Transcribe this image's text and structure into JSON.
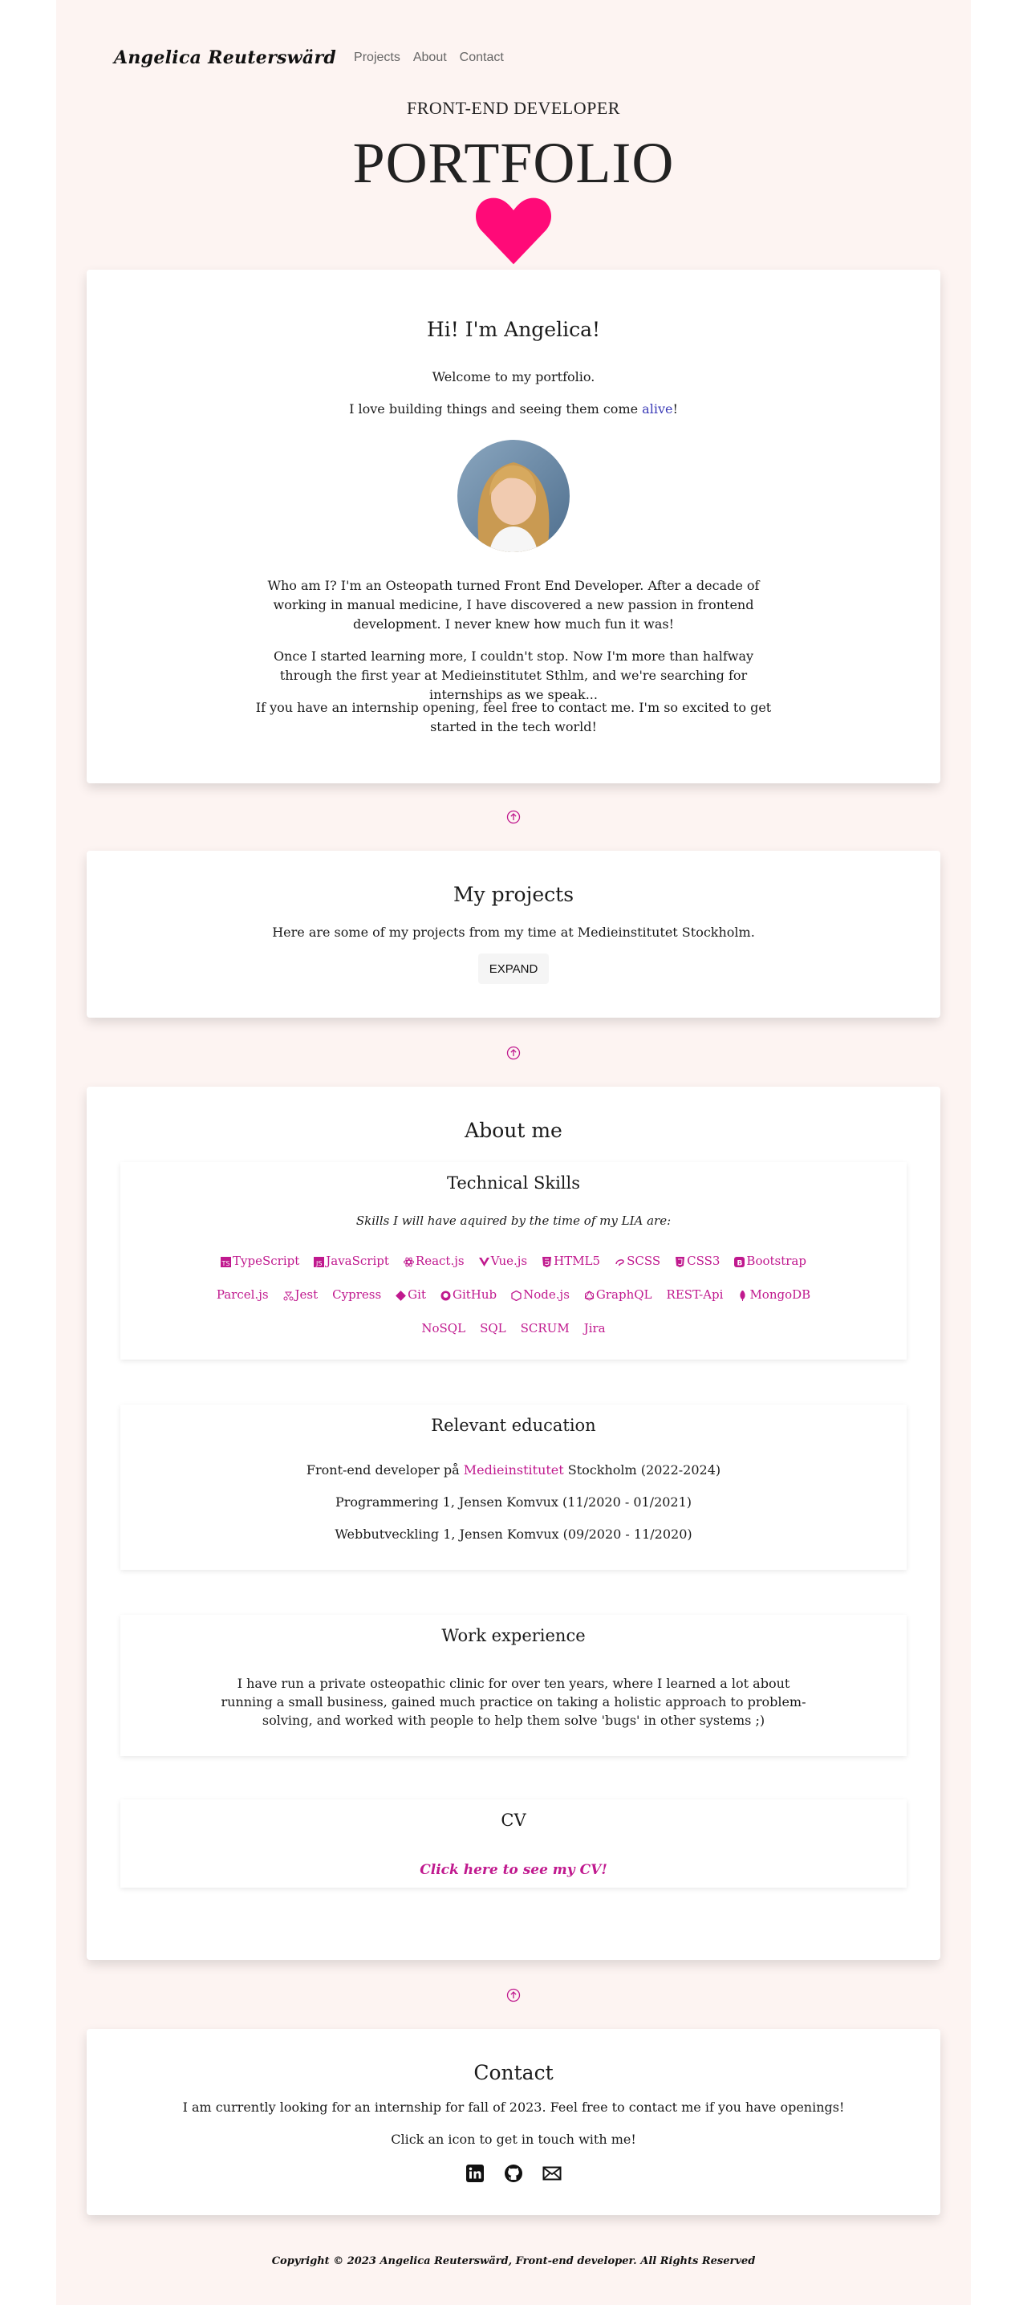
{
  "nav": {
    "brand": "Angelica Reuterswärd",
    "links": [
      "Projects",
      "About",
      "Contact"
    ]
  },
  "hero": {
    "subtitle": "FRONT-END DEVELOPER",
    "title": "PORTFOLIO",
    "heart_color": "#ff0a78"
  },
  "intro": {
    "title": "Hi! I'm Angelica!",
    "welcome": "Welcome to my portfolio.",
    "love_prefix": "I love building things and seeing them come ",
    "love_link": "alive",
    "love_suffix": "!",
    "bio": [
      "Who am I? I'm an Osteopath turned Front End Developer. After a decade of working in manual medicine, I have discovered a new passion in frontend development. I never knew how much fun it was!",
      "Once I started learning more, I couldn't stop. Now I'm more than halfway through the first year at Medieinstitutet Sthlm, and we're searching for internships as we speak...",
      "If you have an internship opening, feel free to contact me. I'm so excited to get started in the tech world!"
    ]
  },
  "projects": {
    "title": "My projects",
    "text": "Here are some of my projects from my time at Medieinstitutet Stockholm.",
    "expand_label": "EXPAND"
  },
  "about": {
    "title": "About me",
    "skills_title": "Technical Skills",
    "skills_intro": "Skills I will have aquired by the time of my LIA are:",
    "skills_row1": [
      "TypeScript",
      "JavaScript",
      "React.js",
      "Vue.js",
      "HTML5",
      "SCSS",
      "CSS3",
      "Bootstrap"
    ],
    "skills_row2": [
      "Parcel.js",
      "Jest",
      "Cypress",
      "Git",
      "GitHub",
      "Node.js",
      "GraphQL",
      "REST-Api",
      "MongoDB"
    ],
    "skills_row3": [
      "NoSQL",
      "SQL",
      "SCRUM",
      "Jira"
    ],
    "education_title": "Relevant education",
    "education": {
      "line1_prefix": "Front-end developer på ",
      "line1_link": "Medieinstitutet",
      "line1_suffix": " Stockholm (2022-2024)",
      "line2": "Programmering 1, Jensen Komvux (11/2020 - 01/2021)",
      "line3": "Webbutveckling 1, Jensen Komvux (09/2020 - 11/2020)"
    },
    "work_title": "Work experience",
    "work_text": "I have run a private osteopathic clinic for over ten years, where I learned a lot about running a small business, gained much practice on taking a holistic approach to problem-solving, and worked with people to help them solve 'bugs' in other systems ;)",
    "cv_title": "CV",
    "cv_link": "Click here to see my CV!"
  },
  "contact": {
    "title": "Contact",
    "text": "I am currently looking for an internship for fall of 2023. Feel free to contact me if you have openings!",
    "cta": "Click an icon to get in touch with me!",
    "icons": [
      "linkedin-icon",
      "github-icon",
      "email-icon"
    ]
  },
  "footer": {
    "text": "Copyright © 2023 Angelica Reuterswärd, Front-end developer. All Rights Reserved"
  },
  "colors": {
    "accent": "#c0198e",
    "page_bg": "#fdf4f2",
    "link_blue": "#3b3bb7"
  }
}
